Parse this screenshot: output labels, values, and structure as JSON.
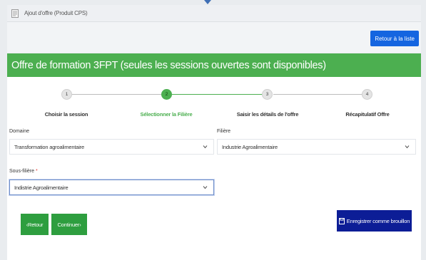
{
  "titlebar": {
    "title": "Ajout d'offre (Produit CPS)"
  },
  "toolbar": {
    "back_to_list_label": "Retour à la liste"
  },
  "card": {
    "title": "Offre de formation 3FPT (seules les sessions ouvertes sont disponibles)"
  },
  "stepper": {
    "steps": [
      {
        "number": "1",
        "label": "Choisir la session"
      },
      {
        "number": "2",
        "label": "Sélectionner la Filière"
      },
      {
        "number": "3",
        "label": "Saisir les détails de l'offre"
      },
      {
        "number": "4",
        "label": "Récapitulatif Offre"
      }
    ],
    "active_step": 2
  },
  "form": {
    "domaine": {
      "label": "Domaine",
      "value": "Transformation agroalimentaire"
    },
    "filiere": {
      "label": "Filière",
      "value": "Industrie Agroalimentaire"
    },
    "sous_filiere": {
      "label": "Sous-filière",
      "required_mark": "*",
      "value": "Indistrie Agroalimentaire"
    }
  },
  "actions": {
    "back_label": "Retour",
    "back_glyph": "‹",
    "continue_label": "Continuer",
    "continue_glyph": "›",
    "draft_label": "Enregistrer comme brouillon"
  },
  "colors": {
    "primary_green": "#4caf50",
    "button_green": "#2e9e3f",
    "blue": "#1565e0",
    "navy": "#0c1d96"
  }
}
